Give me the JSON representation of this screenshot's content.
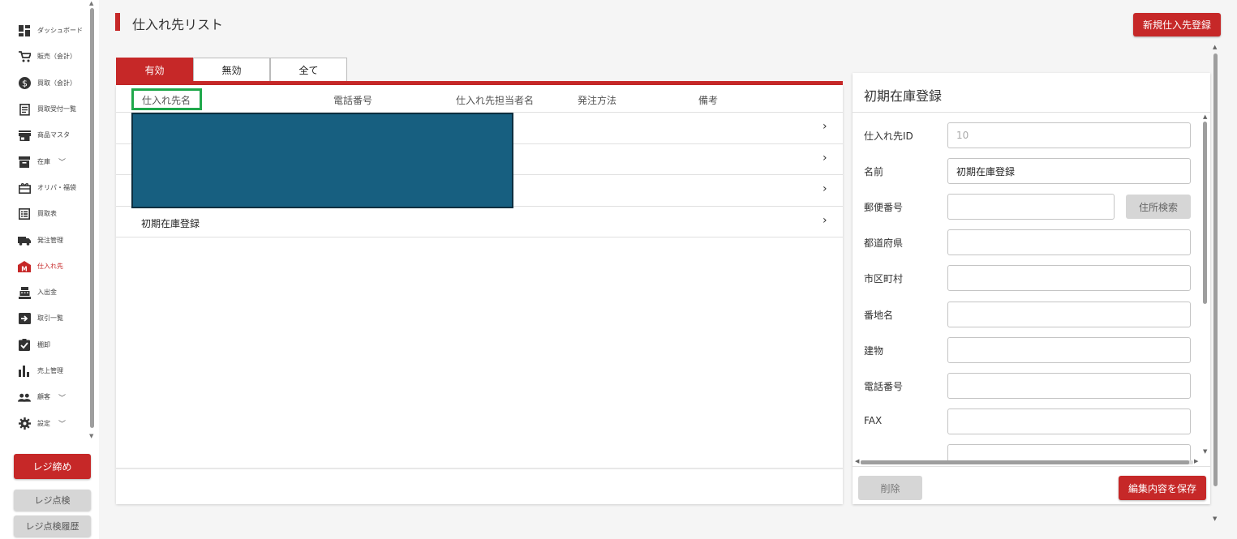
{
  "sidebar": {
    "items": [
      {
        "label": "ダッシュボード",
        "icon": "dashboard-icon"
      },
      {
        "label": "販売（会計）",
        "icon": "cart-icon"
      },
      {
        "label": "買取（会計）",
        "icon": "dollar-icon"
      },
      {
        "label": "買取受付一覧",
        "icon": "receipt-icon"
      },
      {
        "label": "商品マスタ",
        "icon": "store-icon"
      },
      {
        "label": "在庫",
        "icon": "inventory-icon"
      },
      {
        "label": "オリパ・福袋",
        "icon": "gift-icon"
      },
      {
        "label": "買取表",
        "icon": "list-icon"
      },
      {
        "label": "発注管理",
        "icon": "truck-icon"
      },
      {
        "label": "仕入れ先",
        "icon": "supplier-icon"
      },
      {
        "label": "入出金",
        "icon": "register-icon"
      },
      {
        "label": "取引一覧",
        "icon": "transaction-icon"
      },
      {
        "label": "棚卸",
        "icon": "checklist-icon"
      },
      {
        "label": "売上管理",
        "icon": "bar-chart-icon"
      },
      {
        "label": "顧客",
        "icon": "people-icon"
      },
      {
        "label": "設定",
        "icon": "gear-icon"
      }
    ],
    "close_register": "レジ締め",
    "register_check": "レジ点検",
    "register_check_history": "レジ点検履歴"
  },
  "header": {
    "title": "仕入れ先リスト",
    "new_supplier_button": "新規仕入先登録"
  },
  "tabs": [
    {
      "label": "有効"
    },
    {
      "label": "無効"
    },
    {
      "label": "全て"
    }
  ],
  "table": {
    "columns": [
      "仕入れ先名",
      "電話番号",
      "仕入れ先担当者名",
      "発注方法",
      "備考"
    ],
    "rows": [
      {
        "name": ""
      },
      {
        "name": ""
      },
      {
        "name": ""
      },
      {
        "name": "初期在庫登録"
      }
    ],
    "row_arrow": "›"
  },
  "panel": {
    "title": "初期在庫登録",
    "fields": {
      "supplier_id": {
        "label": "仕入れ先ID",
        "value": "10"
      },
      "name": {
        "label": "名前",
        "value": "初期在庫登録"
      },
      "postal_code": {
        "label": "郵便番号",
        "value": ""
      },
      "prefecture": {
        "label": "都道府県",
        "value": ""
      },
      "city": {
        "label": "市区町村",
        "value": ""
      },
      "street": {
        "label": "番地名",
        "value": ""
      },
      "building": {
        "label": "建物",
        "value": ""
      },
      "phone": {
        "label": "電話番号",
        "value": ""
      },
      "fax": {
        "label": "FAX",
        "value": ""
      }
    },
    "address_search_button": "住所検索",
    "delete_button": "削除",
    "save_button": "編集内容を保存"
  },
  "colors": {
    "accent": "#c62828",
    "highlight": "#1fa84b",
    "redaction": "#175f80"
  }
}
